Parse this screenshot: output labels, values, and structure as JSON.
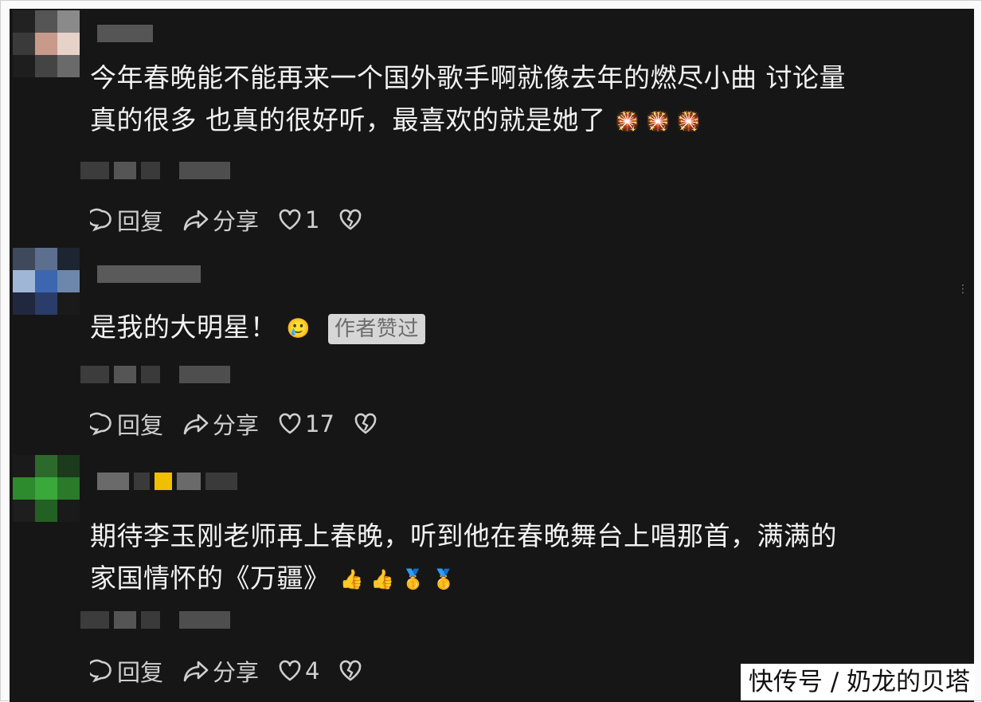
{
  "comments": [
    {
      "text_line1": "今年春晚能不能再来一个国外歌手啊就像去年的燃尽小曲 讨论量",
      "text_line2": "真的很多 也真的很好听，最喜欢的就是她了",
      "emojis": "🎇 🎇 🎇",
      "reply_label": "回复",
      "share_label": "分享",
      "like_count": "1"
    },
    {
      "text_line1": "是我的大明星！",
      "emojis": "🥲",
      "badge": "作者赞过",
      "reply_label": "回复",
      "share_label": "分享",
      "like_count": "17"
    },
    {
      "text_line1": "期待李玉刚老师再上春晚，听到他在春晚舞台上唱那首，满满的",
      "text_line2": "家国情怀的《万疆》",
      "emojis": "👍 👍 🥇 🥇",
      "reply_label": "回复",
      "share_label": "分享",
      "like_count": "4"
    }
  ],
  "more_menu": "⋮",
  "watermark": "快传号 / 奶龙的贝塔",
  "icons": [
    "comment-icon",
    "share-icon",
    "heart-icon",
    "broken-heart-icon"
  ],
  "colors": {
    "background": "#161616",
    "text": "#f2f2f2",
    "badge_bg": "#d6d6d6"
  }
}
